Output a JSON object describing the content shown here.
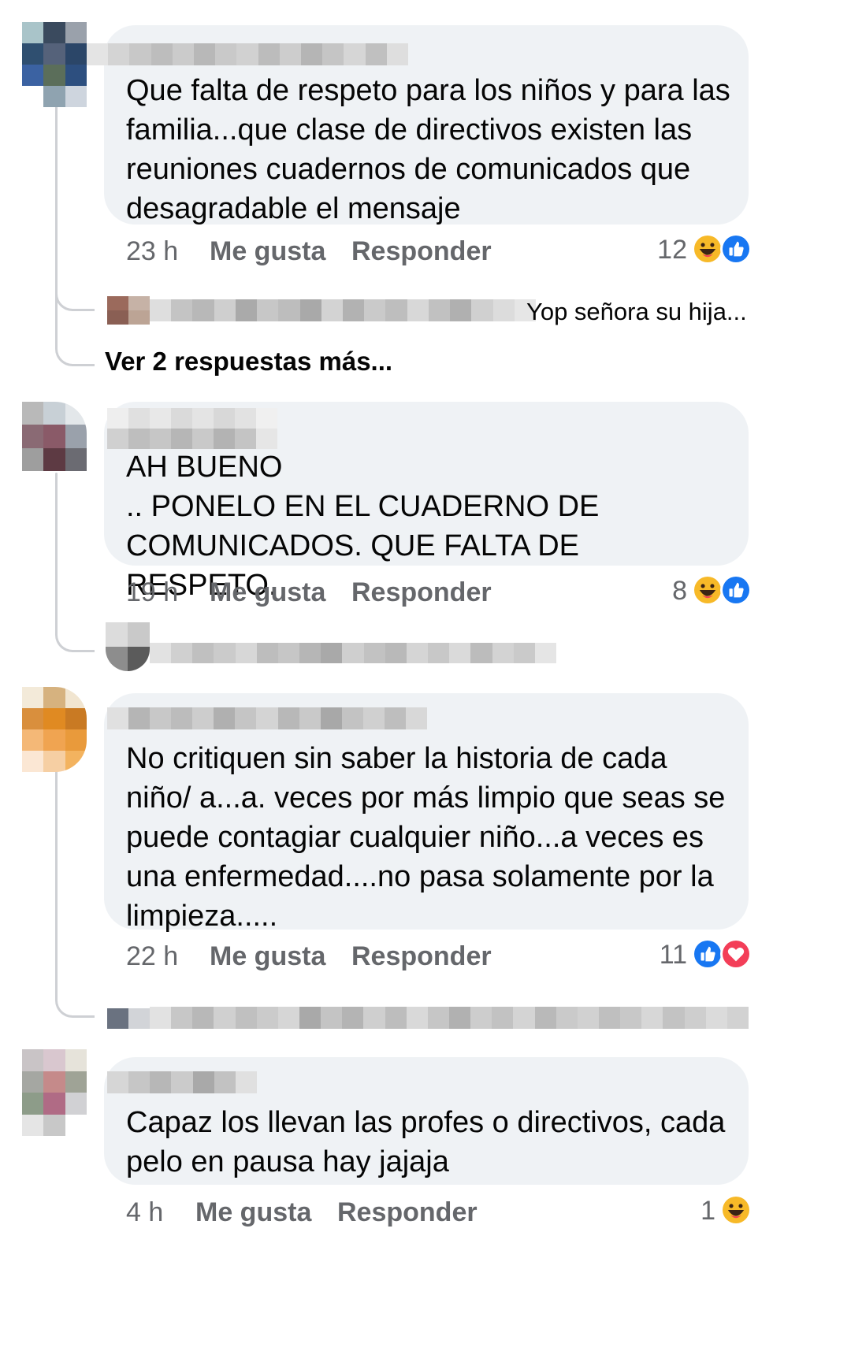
{
  "comments": [
    {
      "author_hidden": true,
      "text": "Que falta de respeto para los niños y para las familia...que clase de directivos existen las reuniones cuadernos de comunicados que desagradable el mensaje",
      "time": "23 h",
      "like_label": "Me gusta",
      "reply_label": "Responder",
      "reaction_count": "12",
      "reactions": [
        "haha-emoji-icon",
        "like-icon"
      ],
      "reply_preview": "Yop señora su hija...",
      "more_replies": "Ver 2 respuestas más..."
    },
    {
      "author_hidden": true,
      "text": "AH BUENO\n.. PONELO EN EL CUADERNO DE COMUNICADOS. QUE FALTA DE RESPETO.",
      "time": "19 h",
      "like_label": "Me gusta",
      "reply_label": "Responder",
      "reaction_count": "8",
      "reactions": [
        "haha-emoji-icon",
        "like-icon"
      ]
    },
    {
      "author_hidden": true,
      "text": "No critiquen sin saber la historia de cada niño/ a...a. veces por más limpio que seas se puede contagiar cualquier niño...a veces es una enfermedad....no pasa solamente por la limpieza.....",
      "time": "22 h",
      "like_label": "Me gusta",
      "reply_label": "Responder",
      "reaction_count": "11",
      "reactions": [
        "like-icon",
        "love-heart-icon"
      ]
    },
    {
      "author_hidden": true,
      "text": "Capaz los llevan las profes o directivos, cada pelo en pausa hay jajaja",
      "time": "4 h",
      "like_label": "Me gusta",
      "reply_label": "Responder",
      "reaction_count": "1",
      "reactions": [
        "haha-emoji-icon"
      ]
    }
  ],
  "colors": {
    "bubble": "#eff2f5",
    "meta": "#65676b",
    "like_blue": "#1877f2",
    "haha_yellow": "#f7b928",
    "love_red": "#f33e58",
    "connector": "#ced0d4"
  }
}
